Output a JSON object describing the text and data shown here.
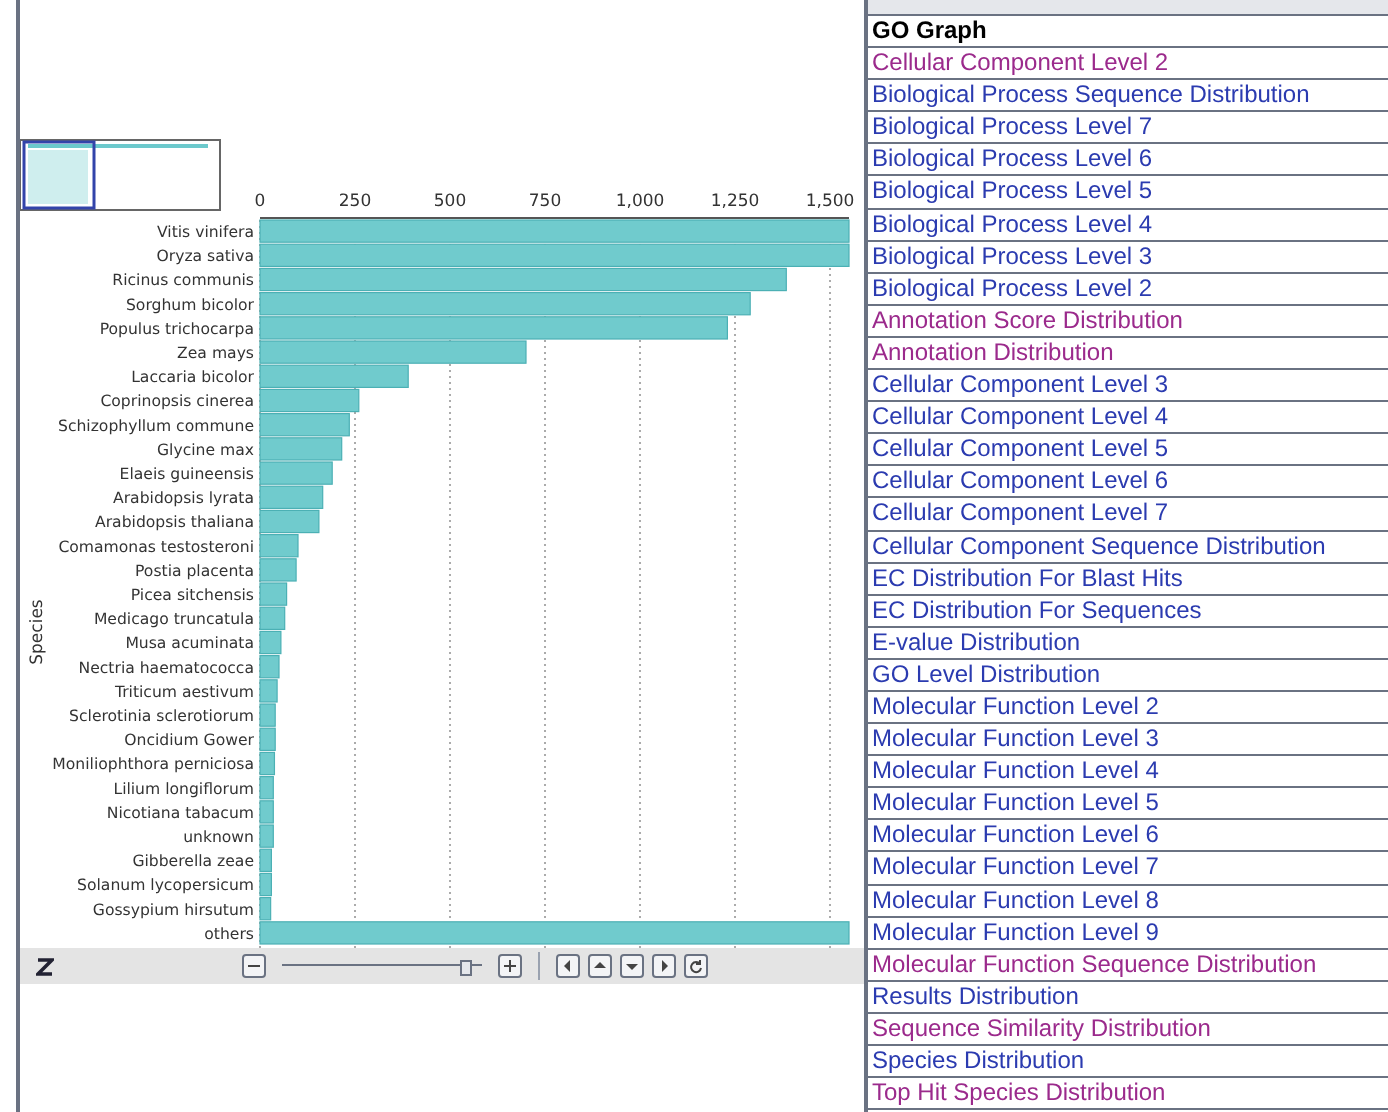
{
  "chart_panel": {
    "chart_data": {
      "type": "bar",
      "orientation": "horizontal",
      "grid": true,
      "ylabel": "Species",
      "xlim": [
        0,
        1550
      ],
      "xticks": [
        0,
        250,
        500,
        750,
        {
          "value": 1000,
          "label": "1,000"
        },
        {
          "value": 1250,
          "label": "1,250"
        },
        {
          "value": 1500,
          "label": "1,500"
        }
      ],
      "categories": [
        "Vitis vinifera",
        "Oryza sativa",
        "Ricinus communis",
        "Sorghum bicolor",
        "Populus trichocarpa",
        "Zea mays",
        "Laccaria bicolor",
        "Coprinopsis cinerea",
        "Schizophyllum commune",
        "Glycine max",
        "Elaeis guineensis",
        "Arabidopsis lyrata",
        "Arabidopsis thaliana",
        "Comamonas testosteroni",
        "Postia placenta",
        "Picea sitchensis",
        "Medicago truncatula",
        "Musa acuminata",
        "Nectria haematococca",
        "Triticum aestivum",
        "Sclerotinia sclerotiorum",
        "Oncidium Gower",
        "Moniliophthora perniciosa",
        "Lilium longiflorum",
        "Nicotiana tabacum",
        "unknown",
        "Gibberella zeae",
        "Solanum lycopersicum",
        "Gossypium hirsutum",
        "others"
      ],
      "values": [
        1550,
        1550,
        1385,
        1290,
        1230,
        700,
        390,
        260,
        235,
        215,
        190,
        165,
        155,
        100,
        95,
        70,
        65,
        55,
        50,
        45,
        40,
        40,
        38,
        35,
        35,
        35,
        30,
        30,
        28,
        1550
      ]
    },
    "zoom_slider": {
      "level": 0.95
    }
  },
  "report_list": {
    "header": "GO Graph",
    "items": [
      {
        "label": "Cellular Component Level 2",
        "visited": true
      },
      {
        "label": "Biological Process Sequence Distribution",
        "visited": false
      },
      {
        "label": "Biological Process Level 7",
        "visited": false
      },
      {
        "label": "Biological Process Level 6",
        "visited": false
      },
      {
        "label": "Biological Process Level 5",
        "visited": false
      },
      {
        "label": "Biological Process Level 4",
        "visited": false
      },
      {
        "label": "Biological Process Level 3",
        "visited": false
      },
      {
        "label": "Biological Process Level 2",
        "visited": false
      },
      {
        "label": "Annotation Score Distribution",
        "visited": true
      },
      {
        "label": "Annotation Distribution",
        "visited": true
      },
      {
        "label": "Cellular Component Level 3",
        "visited": false
      },
      {
        "label": "Cellular Component Level 4",
        "visited": false
      },
      {
        "label": "Cellular Component Level 5",
        "visited": false
      },
      {
        "label": "Cellular Component Level 6",
        "visited": false
      },
      {
        "label": "Cellular Component Level 7",
        "visited": false
      },
      {
        "label": "Cellular Component Sequence Distribution",
        "visited": false
      },
      {
        "label": "EC Distribution For Blast Hits",
        "visited": false
      },
      {
        "label": "EC Distribution For Sequences",
        "visited": false
      },
      {
        "label": "E-value Distribution",
        "visited": false
      },
      {
        "label": "GO Level Distribution",
        "visited": false
      },
      {
        "label": "Molecular Function Level 2",
        "visited": false
      },
      {
        "label": "Molecular Function Level 3",
        "visited": false
      },
      {
        "label": "Molecular Function Level 4",
        "visited": false
      },
      {
        "label": "Molecular Function Level 5",
        "visited": false
      },
      {
        "label": "Molecular Function Level 6",
        "visited": false
      },
      {
        "label": "Molecular Function Level 7",
        "visited": false
      },
      {
        "label": "Molecular Function Level 8",
        "visited": false
      },
      {
        "label": "Molecular Function Level 9",
        "visited": false
      },
      {
        "label": "Molecular Function Sequence Distribution",
        "visited": true
      },
      {
        "label": "Results Distribution",
        "visited": false
      },
      {
        "label": "Sequence Similarity Distribution",
        "visited": true
      },
      {
        "label": "Species Distribution",
        "visited": false
      },
      {
        "label": "Top Hit Species Distribution",
        "visited": true
      }
    ]
  }
}
